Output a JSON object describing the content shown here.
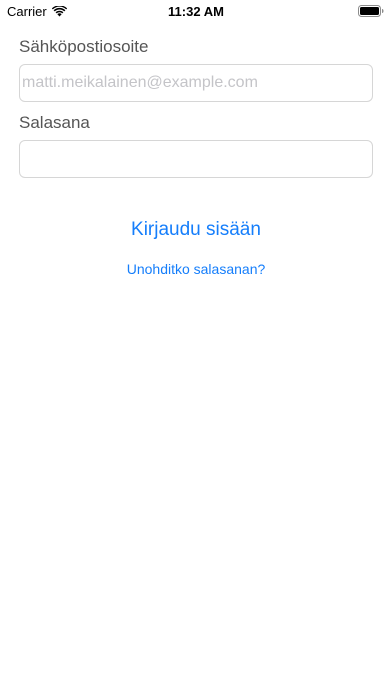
{
  "status_bar": {
    "carrier": "Carrier",
    "time": "11:32 AM",
    "icons": [
      "wifi-icon",
      "battery-icon"
    ]
  },
  "form": {
    "email_label": "Sähköpostiosoite",
    "email_placeholder": "matti.meikalainen@example.com",
    "email_value": "",
    "password_label": "Salasana",
    "password_value": ""
  },
  "actions": {
    "login_label": "Kirjaudu sisään",
    "forgot_label": "Unohditko salasanan?"
  },
  "colors": {
    "accent": "#157efb",
    "label": "#555555",
    "placeholder": "#c4c4c8",
    "field_border": "#d6d6d6",
    "background": "#ffffff"
  }
}
